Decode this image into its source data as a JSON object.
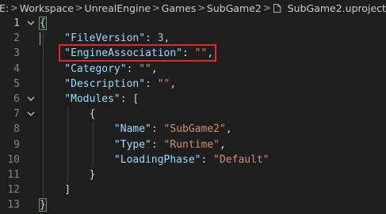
{
  "breadcrumb": {
    "items": [
      "E:",
      "Workspace",
      "UnrealEngine",
      "Games",
      "SubGame2"
    ],
    "file": "SubGame2.uproject",
    "separator": ">"
  },
  "editor": {
    "lines": [
      {
        "num": "1",
        "fold": true,
        "code": [
          [
            "tok-punc",
            "{"
          ]
        ]
      },
      {
        "num": "2",
        "fold": false,
        "code": [
          [
            "tok-key",
            "    \"FileVersion\""
          ],
          [
            "tok-punc",
            ": "
          ],
          [
            "tok-num",
            "3"
          ],
          [
            "tok-punc",
            ","
          ]
        ]
      },
      {
        "num": "3",
        "fold": false,
        "code": [
          [
            "tok-key",
            "    \"EngineAssociation\""
          ],
          [
            "tok-punc",
            ": "
          ],
          [
            "tok-str",
            "\"\""
          ],
          [
            "tok-punc",
            ","
          ]
        ]
      },
      {
        "num": "4",
        "fold": false,
        "code": [
          [
            "tok-key",
            "    \"Category\""
          ],
          [
            "tok-punc",
            ": "
          ],
          [
            "tok-str",
            "\"\""
          ],
          [
            "tok-punc",
            ","
          ]
        ]
      },
      {
        "num": "5",
        "fold": false,
        "code": [
          [
            "tok-key",
            "    \"Description\""
          ],
          [
            "tok-punc",
            ": "
          ],
          [
            "tok-str",
            "\"\""
          ],
          [
            "tok-punc",
            ","
          ]
        ]
      },
      {
        "num": "6",
        "fold": true,
        "code": [
          [
            "tok-key",
            "    \"Modules\""
          ],
          [
            "tok-punc",
            ": ["
          ]
        ]
      },
      {
        "num": "7",
        "fold": true,
        "code": [
          [
            "tok-punc",
            "        {"
          ]
        ]
      },
      {
        "num": "8",
        "fold": false,
        "code": [
          [
            "tok-key",
            "            \"Name\""
          ],
          [
            "tok-punc",
            ": "
          ],
          [
            "tok-str",
            "\"SubGame2\""
          ],
          [
            "tok-punc",
            ","
          ]
        ]
      },
      {
        "num": "9",
        "fold": false,
        "code": [
          [
            "tok-key",
            "            \"Type\""
          ],
          [
            "tok-punc",
            ": "
          ],
          [
            "tok-str",
            "\"Runtime\""
          ],
          [
            "tok-punc",
            ","
          ]
        ]
      },
      {
        "num": "10",
        "fold": false,
        "code": [
          [
            "tok-key",
            "            \"LoadingPhase\""
          ],
          [
            "tok-punc",
            ": "
          ],
          [
            "tok-str",
            "\"Default\""
          ]
        ]
      },
      {
        "num": "11",
        "fold": false,
        "code": [
          [
            "tok-punc",
            "        }"
          ]
        ]
      },
      {
        "num": "12",
        "fold": false,
        "code": [
          [
            "tok-punc",
            "    ]"
          ]
        ]
      },
      {
        "num": "13",
        "fold": false,
        "code": [
          [
            "tok-punc",
            "}"
          ]
        ]
      }
    ],
    "highlighted_line": "3"
  },
  "colors": {
    "background": "#1e1e1e",
    "key": "#9cdcfe",
    "string": "#ce9178",
    "number": "#b5cea8",
    "highlight_box": "#e02a2a"
  },
  "icons": {
    "separator": "chevron-right-icon",
    "file": "file-icon",
    "fold": "chevron-down-icon"
  }
}
